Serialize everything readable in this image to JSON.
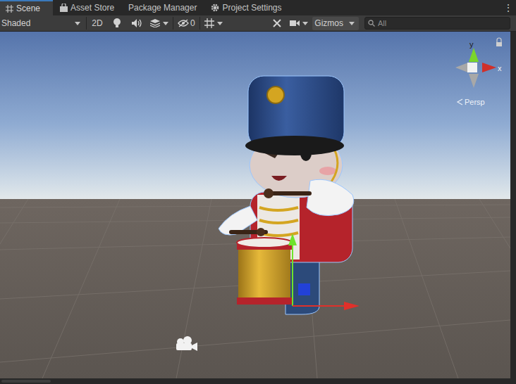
{
  "tabs": [
    {
      "label": "Scene",
      "selected": true
    },
    {
      "label": "Asset Store",
      "selected": false
    },
    {
      "label": "Package Manager",
      "selected": false
    },
    {
      "label": "Project Settings",
      "selected": false
    }
  ],
  "tab_menu": "⋮",
  "toolbar": {
    "shading": "Shaded",
    "mode_2d": {
      "label": "2D",
      "selected": false
    },
    "hidden_count": "0",
    "gizmos": "Gizmos",
    "search": {
      "placeholder": "All"
    }
  },
  "scene_gizmo": {
    "y_label": "y",
    "x_label": "x",
    "projection": "Persp"
  }
}
